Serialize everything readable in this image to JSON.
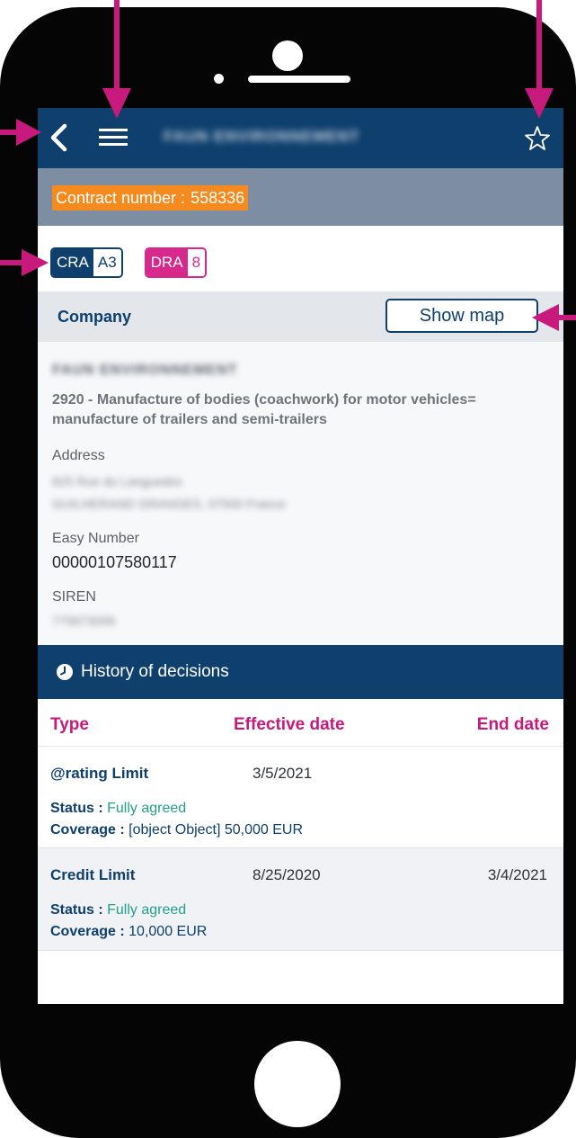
{
  "header": {
    "title": "FAUN ENVIRONNEMENT"
  },
  "contract": {
    "label": "Contract number :",
    "number": "558336"
  },
  "ratings": [
    {
      "key": "CRA",
      "value": "A3"
    },
    {
      "key": "DRA",
      "value": "8"
    }
  ],
  "company": {
    "section_title": "Company",
    "show_map_label": "Show map",
    "name": "FAUN ENVIRONNEMENT",
    "activity": "2920 - Manufacture of bodies (coachwork) for motor vehicles= manufacture of trailers and semi-trailers",
    "address_label": "Address",
    "address_line1": "625 Rue du Languedoc",
    "address_line2": "GUILHERAND GRANGES, 07500 France",
    "easy_number_label": "Easy Number",
    "easy_number": "00000107580117",
    "siren_label": "SIREN",
    "siren": "775673008"
  },
  "history": {
    "title": "History of decisions",
    "columns": {
      "type": "Type",
      "effective_date": "Effective date",
      "end_date": "End date"
    },
    "rows": [
      {
        "type": "@rating Limit",
        "effective_date": "3/5/2021",
        "end_date": "",
        "status_label": "Status :",
        "status": "Fully agreed",
        "coverage_label": "Coverage :",
        "coverage": "[object Object] 50,000 EUR"
      },
      {
        "type": "Credit Limit",
        "effective_date": "8/25/2020",
        "end_date": "3/4/2021",
        "status_label": "Status :",
        "status": "Fully agreed",
        "coverage_label": "Coverage :",
        "coverage": "10,000 EUR"
      }
    ]
  },
  "icons": {
    "back": "chevron-left-icon",
    "menu": "hamburger-menu-icon",
    "favorite": "star-outline-icon",
    "history": "clock-icon"
  },
  "colors": {
    "header": "#0e3f6d",
    "contract_bar": "#7d8ea3",
    "contract_chip": "#f58a1f",
    "dra_accent": "#d7288c",
    "table_header_text": "#c8197c",
    "status_green": "#23a08c",
    "annotation_arrow": "#c8197c"
  }
}
